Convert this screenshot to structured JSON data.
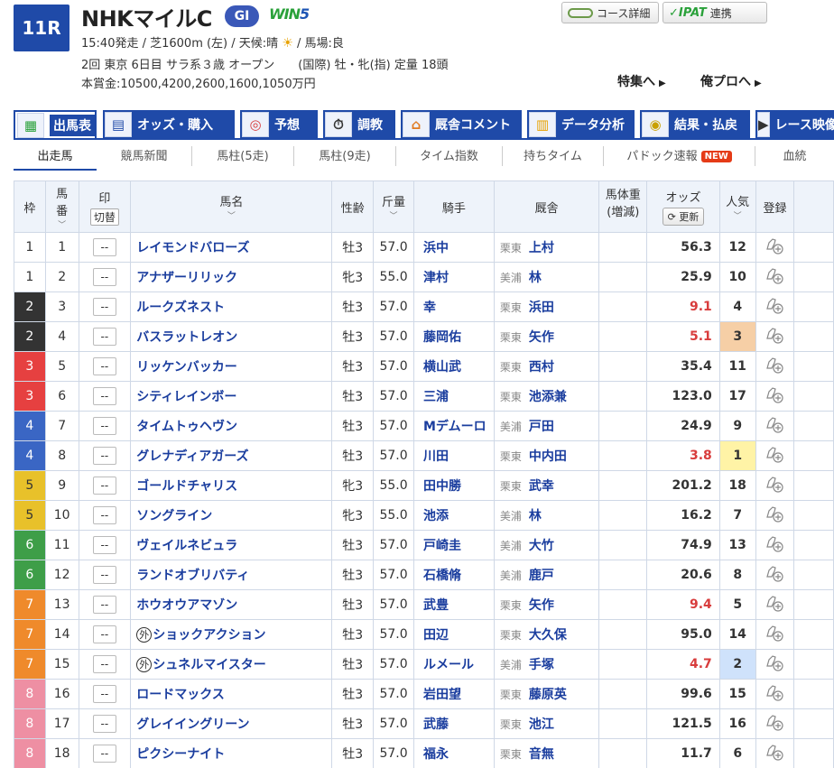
{
  "header": {
    "race_no": "11R",
    "race_name": "NHKマイルC",
    "grade": "GI",
    "win5_a": "WIN",
    "win5_b": "5",
    "line1_a": "15:40発走 / 芝1600m (左) / 天候:晴",
    "line1_b": "/ 馬場:良",
    "line2": "2回 東京 6日目 サラ系３歳 オープン　　(国際) 牡・牝(指) 定量 18頭",
    "line3": "本賞金:10500,4200,2600,1600,1050万円",
    "course_btn": "コース詳細",
    "ipat_logo": "IPAT",
    "ipat_btn": "連携",
    "tokushu": "特集へ",
    "orepro": "俺プロへ"
  },
  "tabs": [
    {
      "label": "出馬表",
      "icon": "table-icon"
    },
    {
      "label": "オッズ・購入",
      "icon": "odds-icon"
    },
    {
      "label": "予想",
      "icon": "target-icon"
    },
    {
      "label": "調教",
      "icon": "stopwatch-icon"
    },
    {
      "label": "厩舎コメント",
      "icon": "stable-icon"
    },
    {
      "label": "データ分析",
      "icon": "bar-chart-icon"
    },
    {
      "label": "結果・払戻",
      "icon": "coins-icon"
    },
    {
      "label": "レース映像",
      "icon": "video-icon"
    }
  ],
  "subtabs": [
    "出走馬",
    "競馬新聞",
    "馬柱(5走)",
    "馬柱(9走)",
    "タイム指数",
    "持ちタイム",
    "パドック速報",
    "血統"
  ],
  "new_badge": "NEW",
  "columns": {
    "waku": "枠",
    "umaban_a": "馬",
    "umaban_b": "番",
    "mark_a": "印",
    "mark_b": "切替",
    "name": "馬名",
    "sex": "性齢",
    "kg": "斤量",
    "jockey": "騎手",
    "trainer": "厩舎",
    "weight_a": "馬体重",
    "weight_b": "(増減)",
    "odds": "オッズ",
    "odds_update": "更新",
    "pop": "人気",
    "reg": "登録"
  },
  "colors": {
    "waku1": "#ffffff",
    "waku2": "#333333",
    "waku3": "#e64040",
    "waku4": "#3a66c4",
    "waku5": "#e8c12a",
    "waku6": "#3e9e48",
    "waku7": "#ef8a2b",
    "waku8": "#ee8fa3"
  },
  "rows": [
    {
      "waku": "1",
      "num": "1",
      "mark": "--",
      "gai": "",
      "name": "レイモンドバローズ",
      "sex": "牡3",
      "kg": "57.0",
      "jockey": "浜中",
      "area": "栗東",
      "trainer": "上村",
      "odds": "56.3",
      "pop": "12"
    },
    {
      "waku": "1",
      "num": "2",
      "mark": "--",
      "gai": "",
      "name": "アナザーリリック",
      "sex": "牝3",
      "kg": "55.0",
      "jockey": "津村",
      "area": "美浦",
      "trainer": "林",
      "odds": "25.9",
      "pop": "10"
    },
    {
      "waku": "2",
      "num": "3",
      "mark": "--",
      "gai": "",
      "name": "ルークズネスト",
      "sex": "牡3",
      "kg": "57.0",
      "jockey": "幸",
      "area": "栗東",
      "trainer": "浜田",
      "odds": "9.1",
      "pop": "4"
    },
    {
      "waku": "2",
      "num": "4",
      "mark": "--",
      "gai": "",
      "name": "バスラットレオン",
      "sex": "牡3",
      "kg": "57.0",
      "jockey": "藤岡佑",
      "area": "栗東",
      "trainer": "矢作",
      "odds": "5.1",
      "pop": "3"
    },
    {
      "waku": "3",
      "num": "5",
      "mark": "--",
      "gai": "",
      "name": "リッケンバッカー",
      "sex": "牡3",
      "kg": "57.0",
      "jockey": "横山武",
      "area": "栗東",
      "trainer": "西村",
      "odds": "35.4",
      "pop": "11"
    },
    {
      "waku": "3",
      "num": "6",
      "mark": "--",
      "gai": "",
      "name": "シティレインボー",
      "sex": "牡3",
      "kg": "57.0",
      "jockey": "三浦",
      "area": "栗東",
      "trainer": "池添兼",
      "odds": "123.0",
      "pop": "17"
    },
    {
      "waku": "4",
      "num": "7",
      "mark": "--",
      "gai": "",
      "name": "タイムトゥヘヴン",
      "sex": "牡3",
      "kg": "57.0",
      "jockey": "Mデムーロ",
      "area": "美浦",
      "trainer": "戸田",
      "odds": "24.9",
      "pop": "9"
    },
    {
      "waku": "4",
      "num": "8",
      "mark": "--",
      "gai": "",
      "name": "グレナディアガーズ",
      "sex": "牡3",
      "kg": "57.0",
      "jockey": "川田",
      "area": "栗東",
      "trainer": "中内田",
      "odds": "3.8",
      "pop": "1"
    },
    {
      "waku": "5",
      "num": "9",
      "mark": "--",
      "gai": "",
      "name": "ゴールドチャリス",
      "sex": "牝3",
      "kg": "55.0",
      "jockey": "田中勝",
      "area": "栗東",
      "trainer": "武幸",
      "odds": "201.2",
      "pop": "18"
    },
    {
      "waku": "5",
      "num": "10",
      "mark": "--",
      "gai": "",
      "name": "ソングライン",
      "sex": "牝3",
      "kg": "55.0",
      "jockey": "池添",
      "area": "美浦",
      "trainer": "林",
      "odds": "16.2",
      "pop": "7"
    },
    {
      "waku": "6",
      "num": "11",
      "mark": "--",
      "gai": "",
      "name": "ヴェイルネビュラ",
      "sex": "牡3",
      "kg": "57.0",
      "jockey": "戸崎圭",
      "area": "美浦",
      "trainer": "大竹",
      "odds": "74.9",
      "pop": "13"
    },
    {
      "waku": "6",
      "num": "12",
      "mark": "--",
      "gai": "",
      "name": "ランドオブリバティ",
      "sex": "牡3",
      "kg": "57.0",
      "jockey": "石橋脩",
      "area": "美浦",
      "trainer": "鹿戸",
      "odds": "20.6",
      "pop": "8"
    },
    {
      "waku": "7",
      "num": "13",
      "mark": "--",
      "gai": "",
      "name": "ホウオウアマゾン",
      "sex": "牡3",
      "kg": "57.0",
      "jockey": "武豊",
      "area": "栗東",
      "trainer": "矢作",
      "odds": "9.4",
      "pop": "5"
    },
    {
      "waku": "7",
      "num": "14",
      "mark": "--",
      "gai": "外",
      "name": "ショックアクション",
      "sex": "牡3",
      "kg": "57.0",
      "jockey": "田辺",
      "area": "栗東",
      "trainer": "大久保",
      "odds": "95.0",
      "pop": "14"
    },
    {
      "waku": "7",
      "num": "15",
      "mark": "--",
      "gai": "外",
      "name": "シュネルマイスター",
      "sex": "牡3",
      "kg": "57.0",
      "jockey": "ルメール",
      "area": "美浦",
      "trainer": "手塚",
      "odds": "4.7",
      "pop": "2"
    },
    {
      "waku": "8",
      "num": "16",
      "mark": "--",
      "gai": "",
      "name": "ロードマックス",
      "sex": "牡3",
      "kg": "57.0",
      "jockey": "岩田望",
      "area": "栗東",
      "trainer": "藤原英",
      "odds": "99.6",
      "pop": "15"
    },
    {
      "waku": "8",
      "num": "17",
      "mark": "--",
      "gai": "",
      "name": "グレイイングリーン",
      "sex": "牡3",
      "kg": "57.0",
      "jockey": "武藤",
      "area": "栗東",
      "trainer": "池江",
      "odds": "121.5",
      "pop": "16"
    },
    {
      "waku": "8",
      "num": "18",
      "mark": "--",
      "gai": "",
      "name": "ピクシーナイト",
      "sex": "牡3",
      "kg": "57.0",
      "jockey": "福永",
      "area": "栗東",
      "trainer": "音無",
      "odds": "11.7",
      "pop": "6"
    }
  ]
}
